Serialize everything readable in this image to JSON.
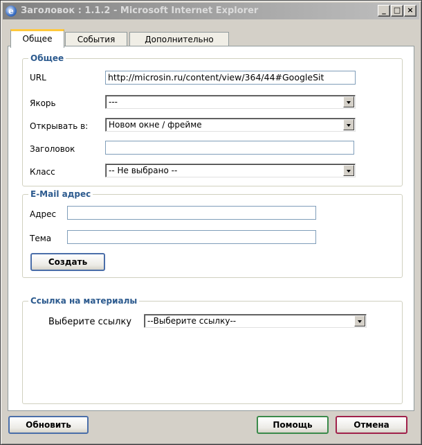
{
  "window": {
    "title": "Заголовок : 1.1.2 - Microsoft Internet Explorer",
    "minimize": "_",
    "maximize": "□",
    "close": "×"
  },
  "tabs": [
    {
      "label": "Общее",
      "active": true
    },
    {
      "label": "События",
      "active": false
    },
    {
      "label": "Дополнительно",
      "active": false
    }
  ],
  "general": {
    "legend": "Общее",
    "url_label": "URL",
    "url_value": "http://microsin.ru/content/view/364/44#GoogleSit",
    "anchor_label": "Якорь",
    "anchor_value": "---",
    "target_label": "Открывать в:",
    "target_value": "Новом окне / фрейме",
    "title_label": "Заголовок",
    "title_value": "",
    "class_label": "Класс",
    "class_value": "-- Не выбрано --"
  },
  "email": {
    "legend": "E-Mail адрес",
    "address_label": "Адрес",
    "address_value": "",
    "subject_label": "Тема",
    "subject_value": "",
    "create_button": "Создать"
  },
  "materials": {
    "legend": "Ссылка на материалы",
    "choose_label": "Выберите ссылку",
    "choose_value": "--Выберите ссылку--"
  },
  "footer": {
    "update_button": "Обновить",
    "help_button": "Помощь",
    "cancel_button": "Отмена"
  },
  "colors": {
    "legend_text": "#2c5a8e",
    "active_tab_accent": "#ffc83c",
    "help_border": "#3a8a4a",
    "cancel_border": "#a0204a"
  }
}
